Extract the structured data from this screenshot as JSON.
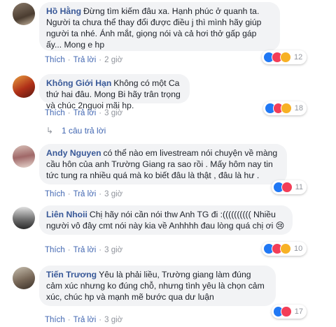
{
  "comments": [
    {
      "name": "Hồ Hằng",
      "text": "Đừng tìm kiếm đâu xa. Hạnh phúc ở quanh ta. Người ta chưa thể thay đổi được điều j thì mình hãy giúp người ta nhé. Ánh mắt, giọng nói và cả hơi thở gấp gáp ấy... Mong e hp",
      "like_label": "Thích",
      "reply_label": "Trả lời",
      "time": "2 giờ",
      "reactions": [
        "like-icon",
        "love-icon",
        "haha-icon"
      ],
      "reaction_count": "12"
    },
    {
      "name": "Không Giới Hạn",
      "text": "Không có một Ca thứ hai đâu. Mong Bi hãy trân trọng và chúc 2nguoi mãi hp.",
      "like_label": "Thích",
      "reply_label": "Trả lời",
      "time": "3 giờ",
      "reactions": [
        "like-icon",
        "love-icon",
        "wow-icon"
      ],
      "reaction_count": "18",
      "replies_label": "1 câu trả lời"
    },
    {
      "name": "Andy Nguyen",
      "text": "có thể nào em livestream nói chuyện về màng cầu hôn của anh Trường Giang ra sao rồi . Mấy hôm nay tin tức tung ra nhiều quá mà ko biết đâu là thật , đâu là hư .",
      "like_label": "Thích",
      "reply_label": "Trả lời",
      "time": "3 giờ",
      "reactions": [
        "like-icon",
        "love-icon"
      ],
      "reaction_count": "11"
    },
    {
      "name": "Liên Nhoii",
      "text": "Chị hãy nói cần nói thw Anh TG đi :(((((((((( Nhiều người vô đây cmt nói này kia về Anhhhh đau lòng quá chị ơi 😢",
      "like_label": "Thích",
      "reply_label": "Trả lời",
      "time": "3 giờ",
      "reactions": [
        "like-icon",
        "love-icon",
        "haha-icon"
      ],
      "reaction_count": "10"
    },
    {
      "name": "Tiến Trương",
      "text": "Yêu là phải liều, Trường giang làm đúng cảm xúc nhưng ko đúng chỗ, nhưng tình yêu là chọn cảm xúc, chúc hp và mạnh mẽ bước qua dư luận",
      "like_label": "Thích",
      "reply_label": "Trả lời",
      "time": "3 giờ",
      "reactions": [
        "like-icon",
        "love-icon"
      ],
      "reaction_count": "17"
    }
  ],
  "colors": {
    "name_blue": "#385898",
    "link_blue": "#4267b2",
    "bubble_bg": "#f2f3f5",
    "meta_gray": "#90949c",
    "like_blue": "#2078f4",
    "love_red": "#f33e58",
    "haha_yellow": "#f7b125"
  }
}
